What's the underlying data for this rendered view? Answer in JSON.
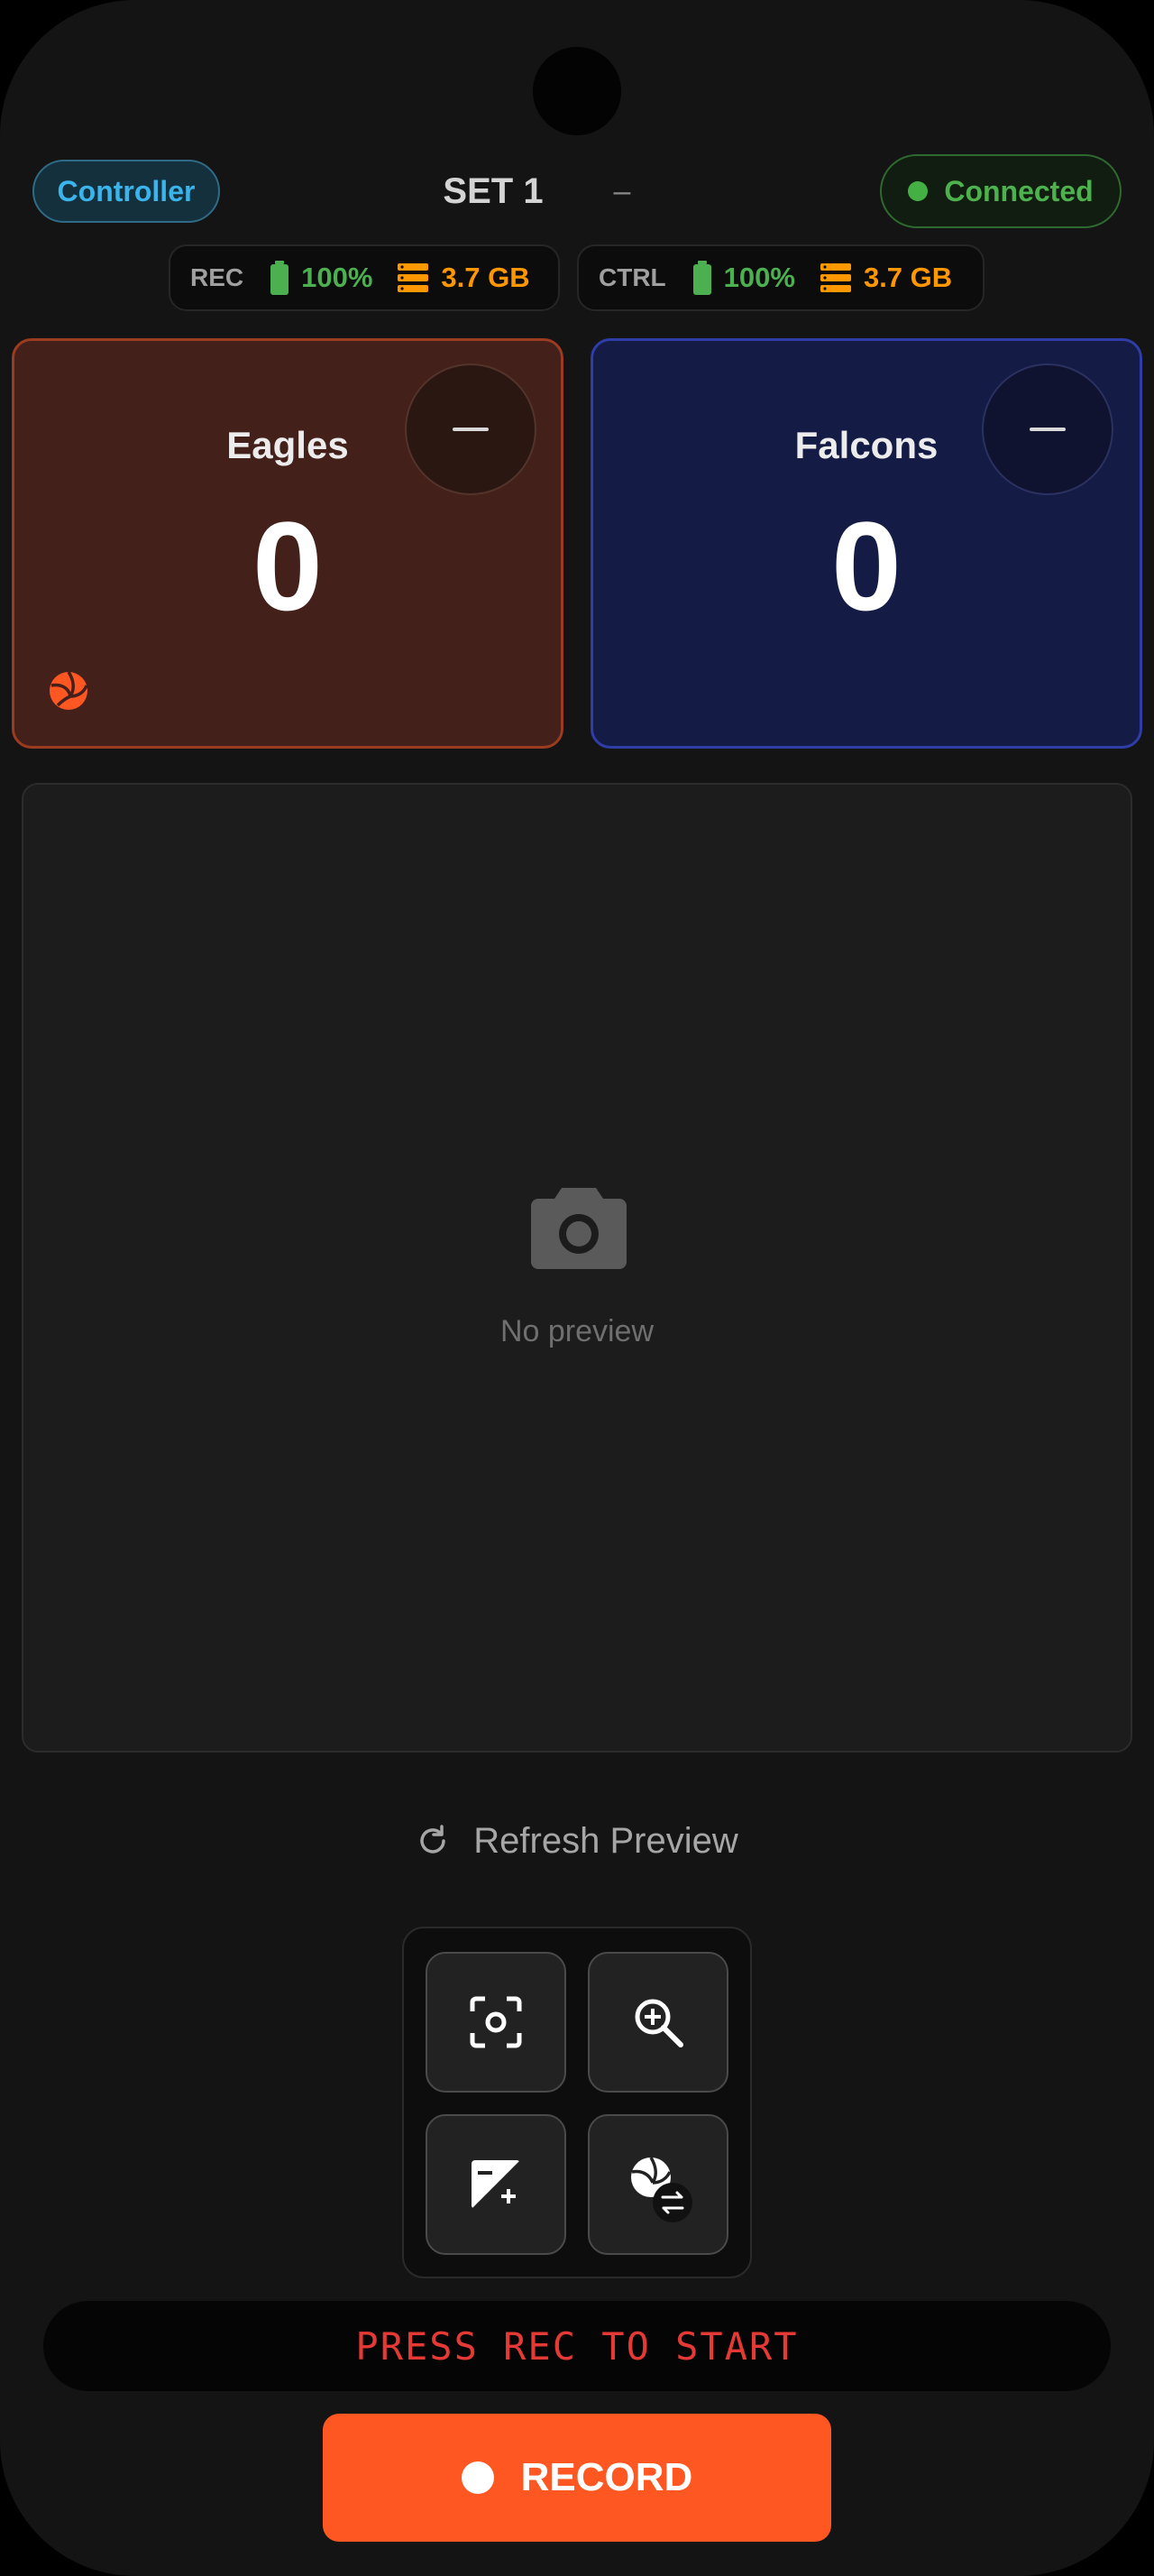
{
  "header": {
    "role": "Controller",
    "set_label": "SET 1",
    "set_dash": "–",
    "connection": "Connected"
  },
  "status": {
    "rec": {
      "label": "REC",
      "battery": "100%",
      "storage": "3.7 GB"
    },
    "ctrl": {
      "label": "CTRL",
      "battery": "100%",
      "storage": "3.7 GB"
    }
  },
  "teams": {
    "home": {
      "name": "Eagles",
      "score": "0",
      "color": "#ff5722",
      "serving": true
    },
    "away": {
      "name": "Falcons",
      "score": "0",
      "color": "#2f3da8",
      "serving": false
    }
  },
  "preview": {
    "empty_text": "No preview",
    "refresh_label": "Refresh Preview"
  },
  "controls": {
    "icons": [
      "focus-icon",
      "zoom-in-icon",
      "exposure-icon",
      "swap-serve-icon"
    ]
  },
  "footer": {
    "status_text": "PRESS REC TO START",
    "record_label": "RECORD"
  },
  "colors": {
    "accent": "#ff5722",
    "connected": "#4caf50",
    "storage": "#ff9800",
    "alert": "#e53935"
  }
}
